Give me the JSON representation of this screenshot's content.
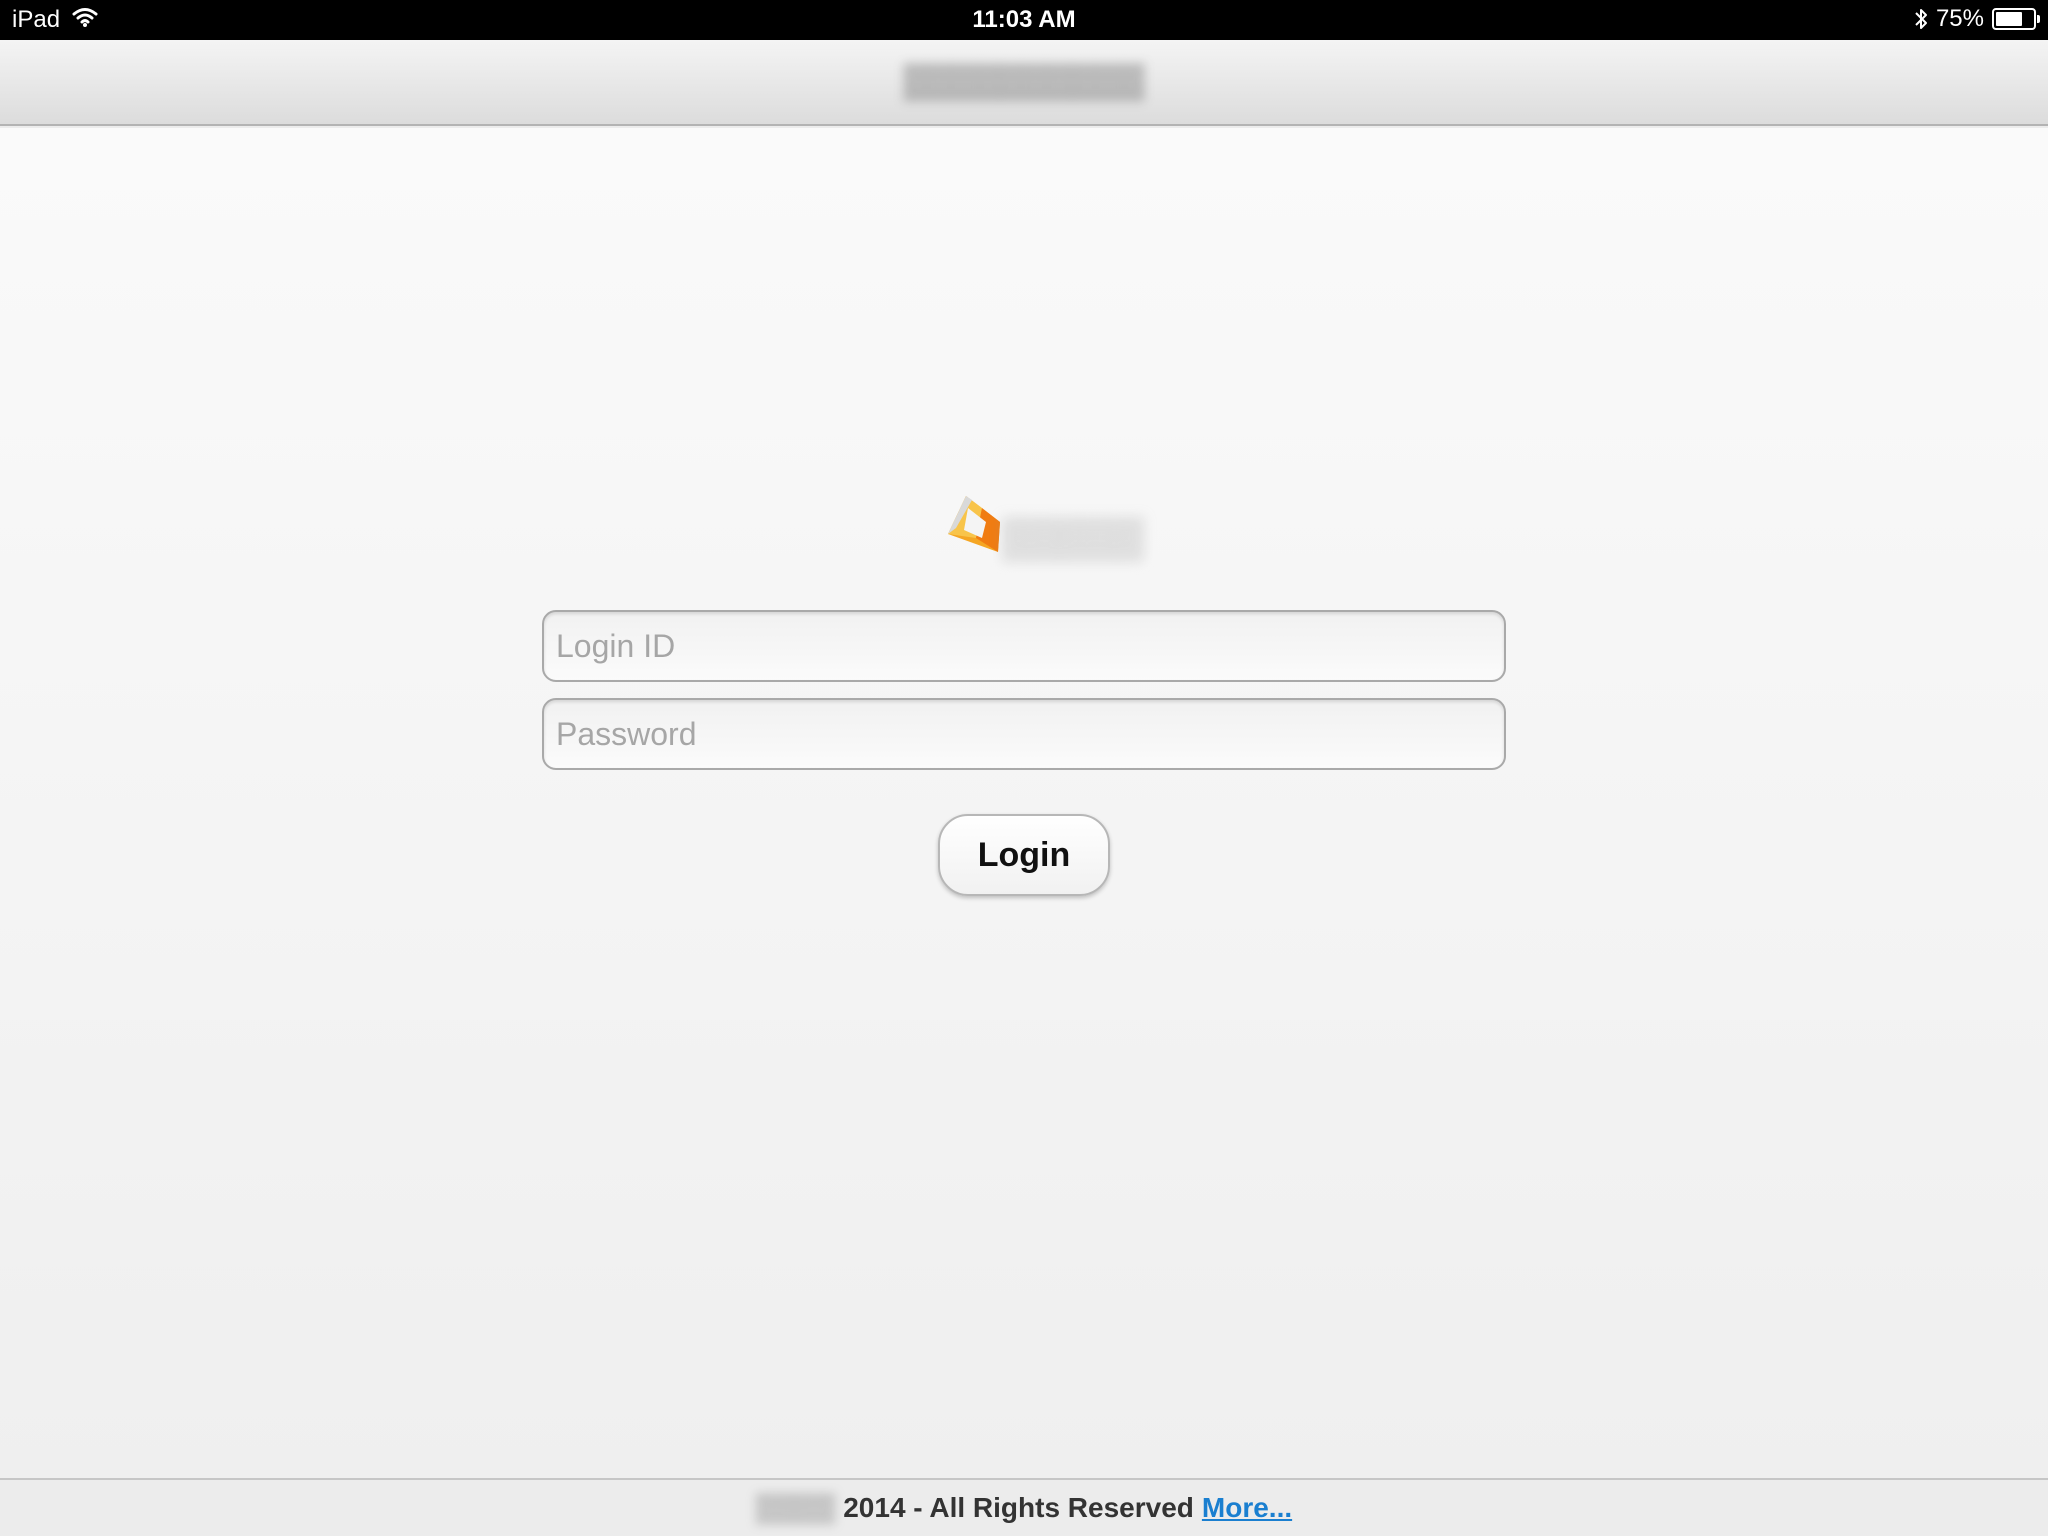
{
  "status_bar": {
    "device": "iPad",
    "time": "11:03 AM",
    "battery_percent_label": "75%",
    "battery_level": 0.75,
    "wifi_icon": "wifi-icon",
    "bluetooth_icon": "bluetooth-icon"
  },
  "nav": {
    "title": "▒▒▒▒▒▒▒▒▒▒"
  },
  "logo": {
    "text": "▒▒▒▒▒",
    "colors": [
      "#f5a623",
      "#f07c12",
      "#d9d9d9"
    ]
  },
  "form": {
    "login_placeholder": "Login ID",
    "password_placeholder": "Password",
    "login_value": "",
    "password_value": "",
    "login_button": "Login"
  },
  "footer": {
    "brand": "▒▒▒▒",
    "text": "2014 - All Rights Reserved",
    "link": "More..."
  },
  "colors": {
    "link": "#1a7fd0",
    "status_bar": "#000000"
  }
}
